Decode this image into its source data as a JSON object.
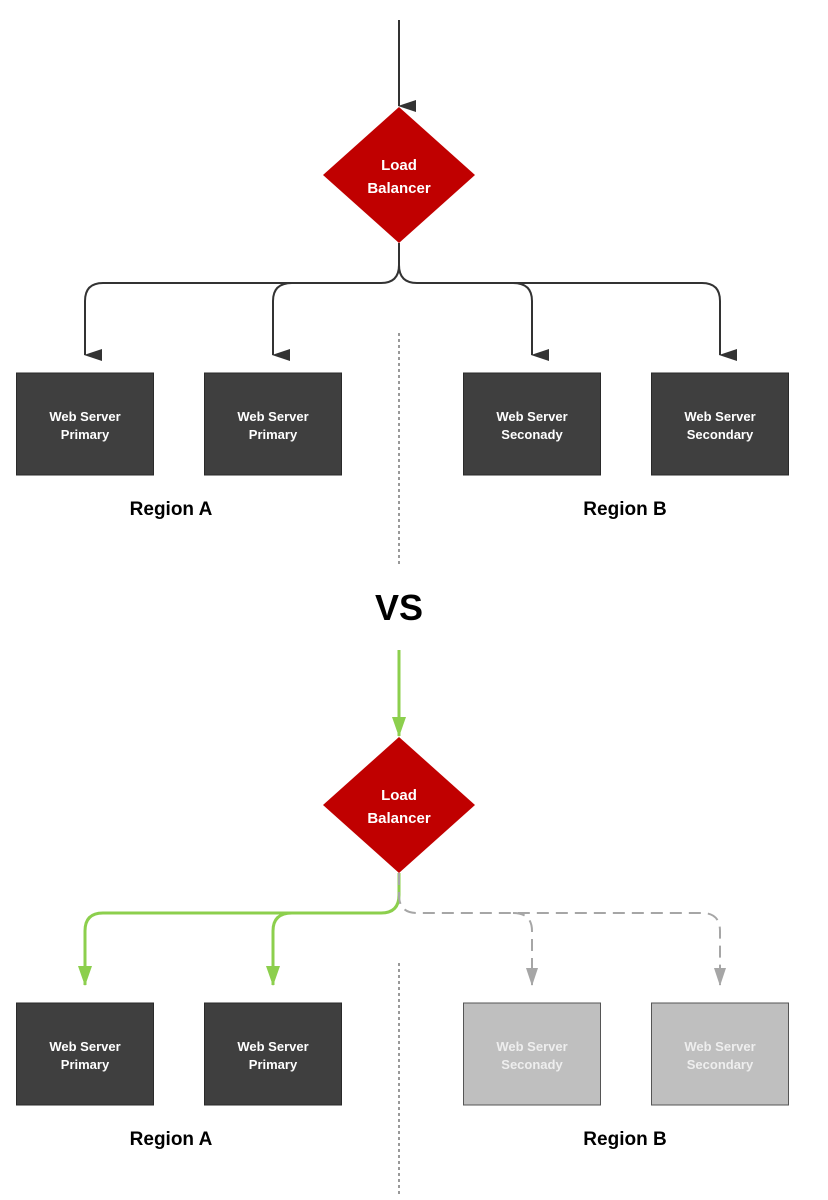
{
  "colors": {
    "load_balancer": "#c00000",
    "server_active": "#3f3f3f",
    "server_inactive": "#bfbfbf",
    "connector_default": "#333333",
    "connector_active": "#8ccf4d",
    "connector_inactive": "#a6a6a6"
  },
  "separator_label": "VS",
  "diagrams": [
    {
      "load_balancer": {
        "line1": "Load",
        "line2": "Balancer"
      },
      "servers": [
        {
          "line1": "Web Server",
          "line2": "Primary",
          "state": "active"
        },
        {
          "line1": "Web Server",
          "line2": "Primary",
          "state": "active"
        },
        {
          "line1": "Web Server",
          "line2": "Seconady",
          "state": "active"
        },
        {
          "line1": "Web Server",
          "line2": "Secondary",
          "state": "active"
        }
      ],
      "regions": [
        "Region A",
        "Region B"
      ]
    },
    {
      "load_balancer": {
        "line1": "Load",
        "line2": "Balancer"
      },
      "servers": [
        {
          "line1": "Web Server",
          "line2": "Primary",
          "state": "active"
        },
        {
          "line1": "Web Server",
          "line2": "Primary",
          "state": "active"
        },
        {
          "line1": "Web Server",
          "line2": "Seconady",
          "state": "inactive"
        },
        {
          "line1": "Web Server",
          "line2": "Secondary",
          "state": "inactive"
        }
      ],
      "regions": [
        "Region A",
        "Region B"
      ]
    }
  ]
}
